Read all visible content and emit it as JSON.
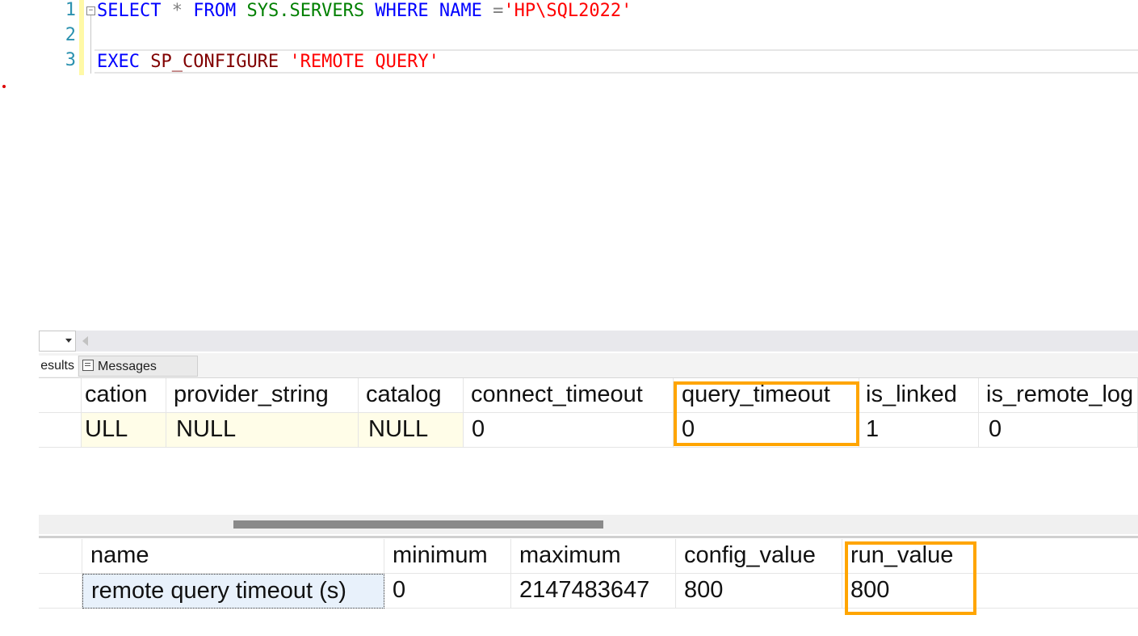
{
  "editor": {
    "line_numbers": [
      "1",
      "2",
      "3"
    ],
    "line1": {
      "select": "SELECT",
      "star": " * ",
      "from": "FROM",
      "space1": " ",
      "sys_servers": "SYS.SERVERS",
      "space2": " ",
      "where": "WHERE",
      "space3": " ",
      "name": "NAME",
      "eq": " =",
      "value": "'HP\\SQL2022'"
    },
    "line3": {
      "exec": "EXEC",
      "space": " ",
      "proc": "SP_CONFIGURE",
      "space2": " ",
      "arg": "'REMOTE QUERY'"
    },
    "fold_glyph": "−"
  },
  "results_pane": {
    "tabs": {
      "results": "esults",
      "messages": "Messages"
    },
    "grid1": {
      "headers": [
        "cation",
        "provider_string",
        "catalog",
        "connect_timeout",
        "query_timeout",
        "is_linked",
        "is_remote_log"
      ],
      "row": [
        "ULL",
        "NULL",
        "NULL",
        "0",
        "0",
        "1",
        "0"
      ]
    },
    "grid2": {
      "headers": [
        "name",
        "minimum",
        "maximum",
        "config_value",
        "run_value"
      ],
      "row": [
        "remote query timeout (s)",
        "0",
        "2147483647",
        "800",
        "800"
      ]
    },
    "highlight_color": "#ffa500"
  }
}
